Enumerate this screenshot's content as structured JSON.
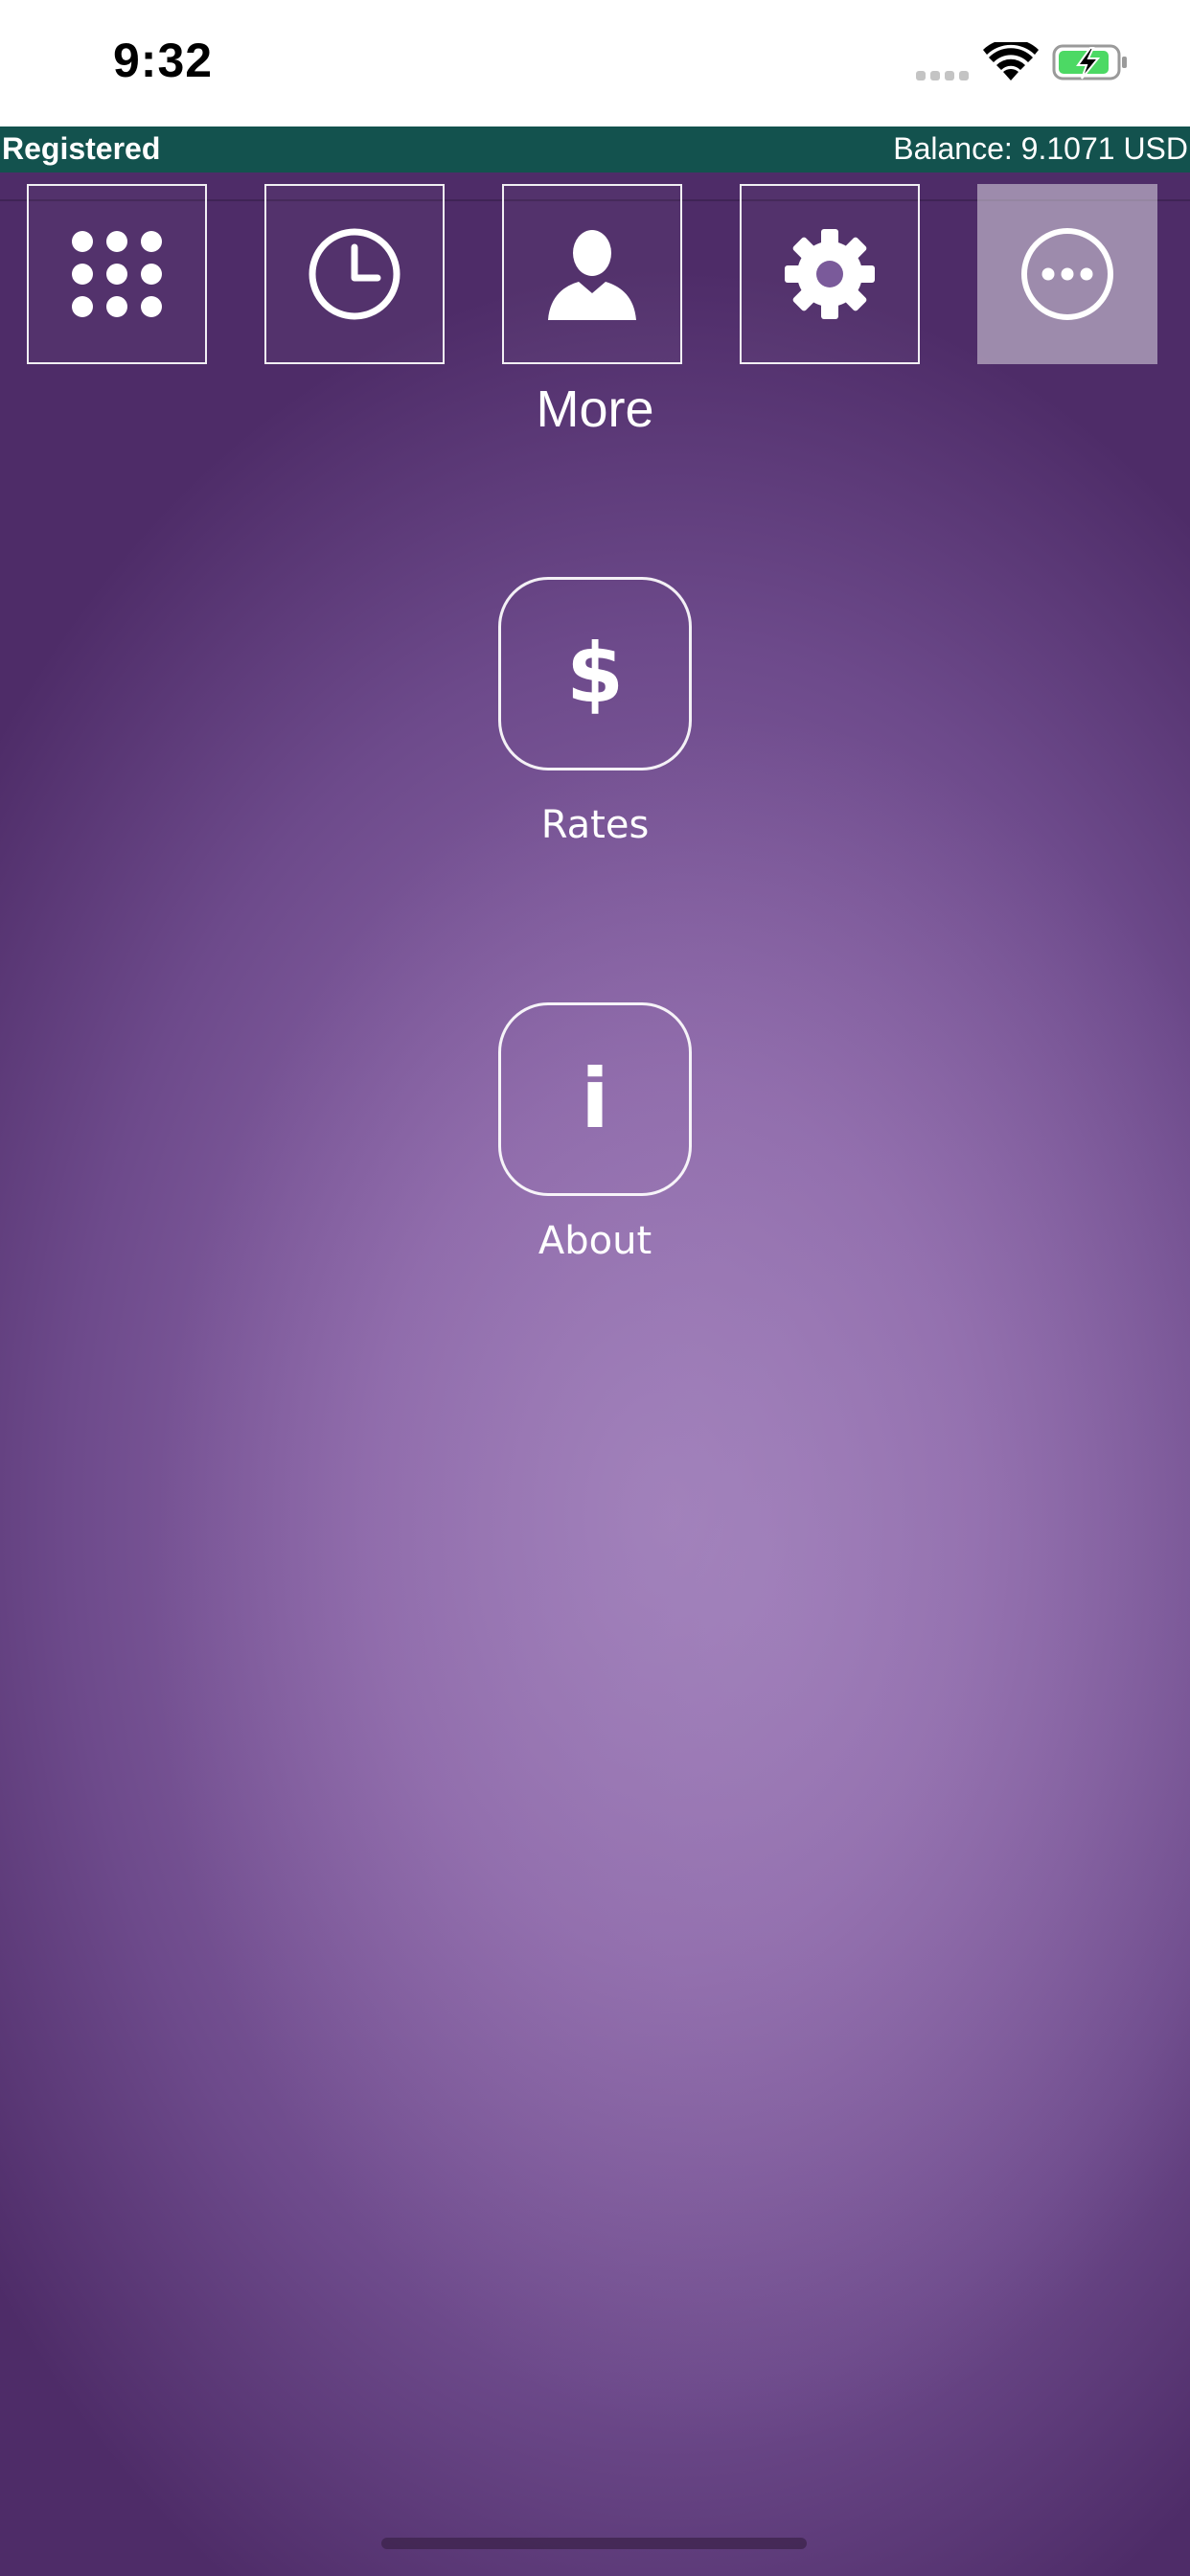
{
  "status_bar": {
    "time": "9:32"
  },
  "account_bar": {
    "status": "Registered",
    "balance": "Balance: 9.1071 USD",
    "color": "#13524e"
  },
  "tabs": [
    {
      "id": "dialpad",
      "icon": "dialpad-icon",
      "active": false
    },
    {
      "id": "history",
      "icon": "clock-icon",
      "active": false
    },
    {
      "id": "contacts",
      "icon": "person-icon",
      "active": false
    },
    {
      "id": "settings",
      "icon": "gear-icon",
      "active": false
    },
    {
      "id": "more",
      "icon": "ellipsis-icon",
      "active": true
    }
  ],
  "page": {
    "title": "More"
  },
  "menu": {
    "items": [
      {
        "label": "Rates",
        "glyph": "$",
        "icon": "dollar-icon"
      },
      {
        "label": "About",
        "glyph": "i",
        "icon": "info-icon"
      }
    ]
  },
  "theme": {
    "accent": "#7a559a"
  }
}
